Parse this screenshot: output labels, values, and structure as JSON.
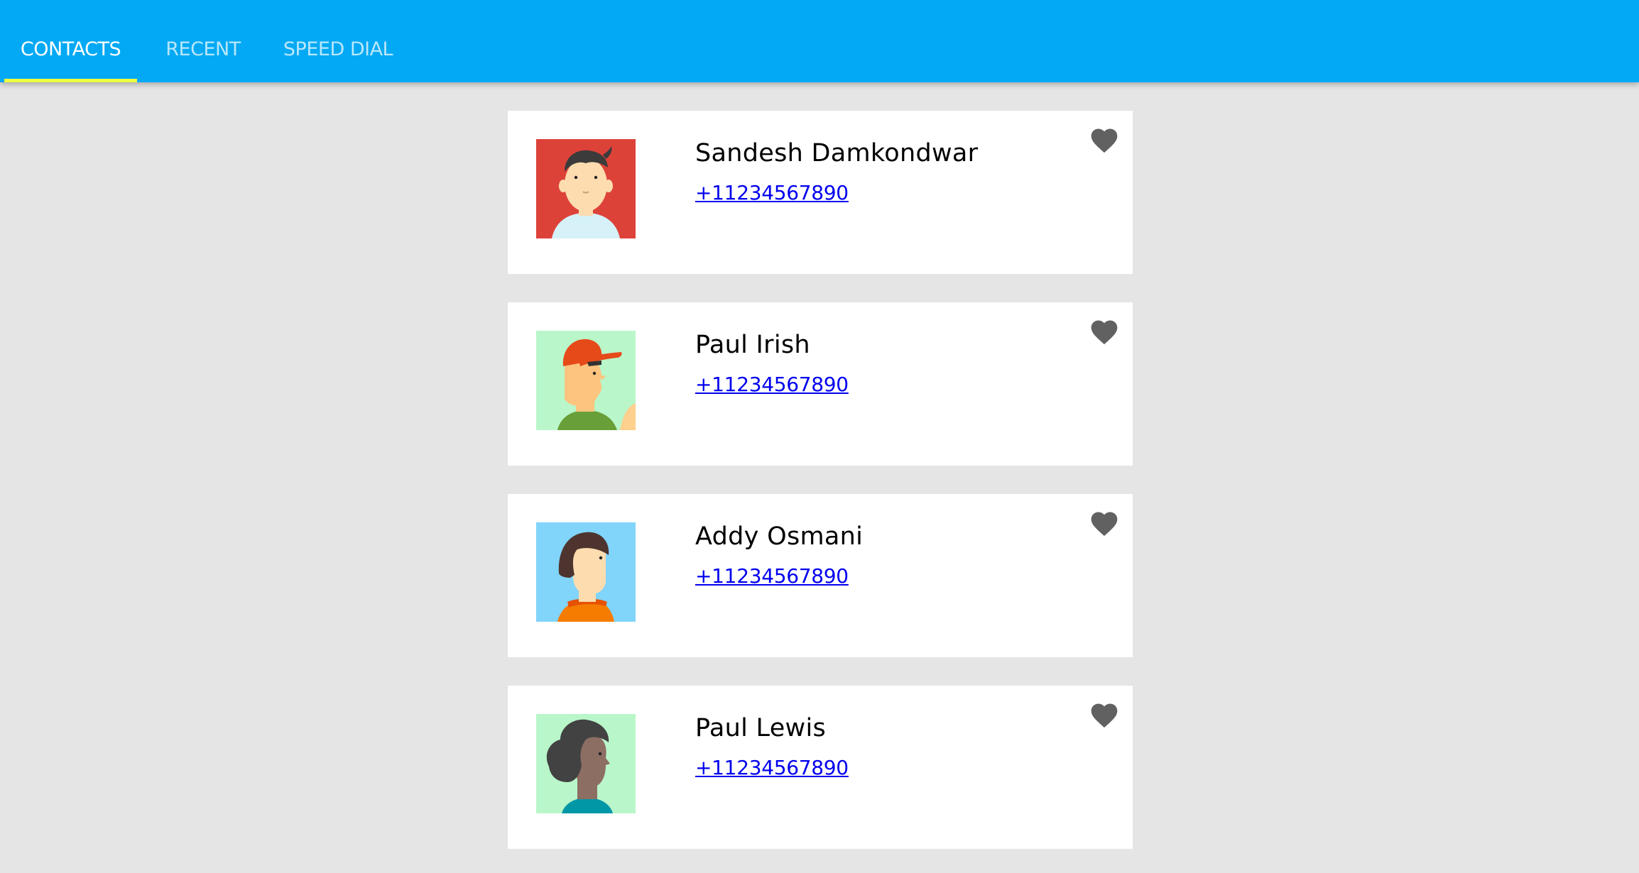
{
  "tabs": [
    {
      "label": "CONTACTS",
      "active": true
    },
    {
      "label": "RECENT",
      "active": false
    },
    {
      "label": "SPEED DIAL",
      "active": false
    }
  ],
  "colors": {
    "header": "#03a9f4",
    "indicator": "#eeff41",
    "background": "#e5e5e5",
    "link": "#0000ee",
    "heart": "#616161"
  },
  "contacts": [
    {
      "name": "Sandesh Damkondwar",
      "phone": "+11234567890",
      "avatar": "avatar-boy-red-background",
      "favorite_icon": "heart-icon"
    },
    {
      "name": "Paul Irish",
      "phone": "+11234567890",
      "avatar": "avatar-boy-cap-green-background",
      "favorite_icon": "heart-icon"
    },
    {
      "name": "Addy Osmani",
      "phone": "+11234567890",
      "avatar": "avatar-girl-blue-background",
      "favorite_icon": "heart-icon"
    },
    {
      "name": "Paul Lewis",
      "phone": "+11234567890",
      "avatar": "avatar-curly-hair-green-background",
      "favorite_icon": "heart-icon"
    }
  ]
}
